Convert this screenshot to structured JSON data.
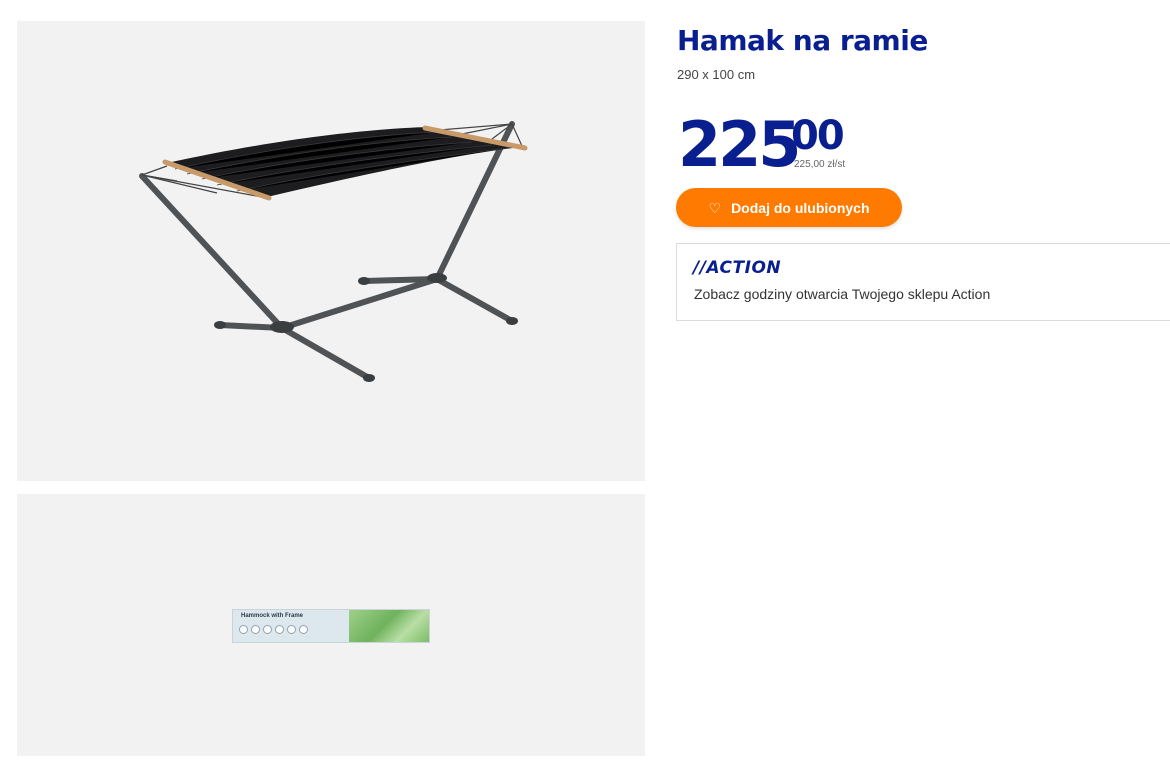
{
  "product": {
    "title": "Hamak na ramie",
    "size": "290 x 100 cm",
    "price_int": "225",
    "price_dec": "00",
    "unit_price": "225,00 zł/st"
  },
  "actions": {
    "favorite_label": "Dodaj do ulubionych",
    "favorite_icon": "heart-outline-icon"
  },
  "store": {
    "logo_text": "//ACTION",
    "hours_link": "Zobacz godziny otwarcia Twojego sklepu Action"
  },
  "gallery": {
    "box_label": "Hammock with Frame"
  },
  "colors": {
    "brand_blue": "#0a1f8f",
    "accent_orange": "#ff7a00",
    "image_bg": "#f2f2f2"
  }
}
